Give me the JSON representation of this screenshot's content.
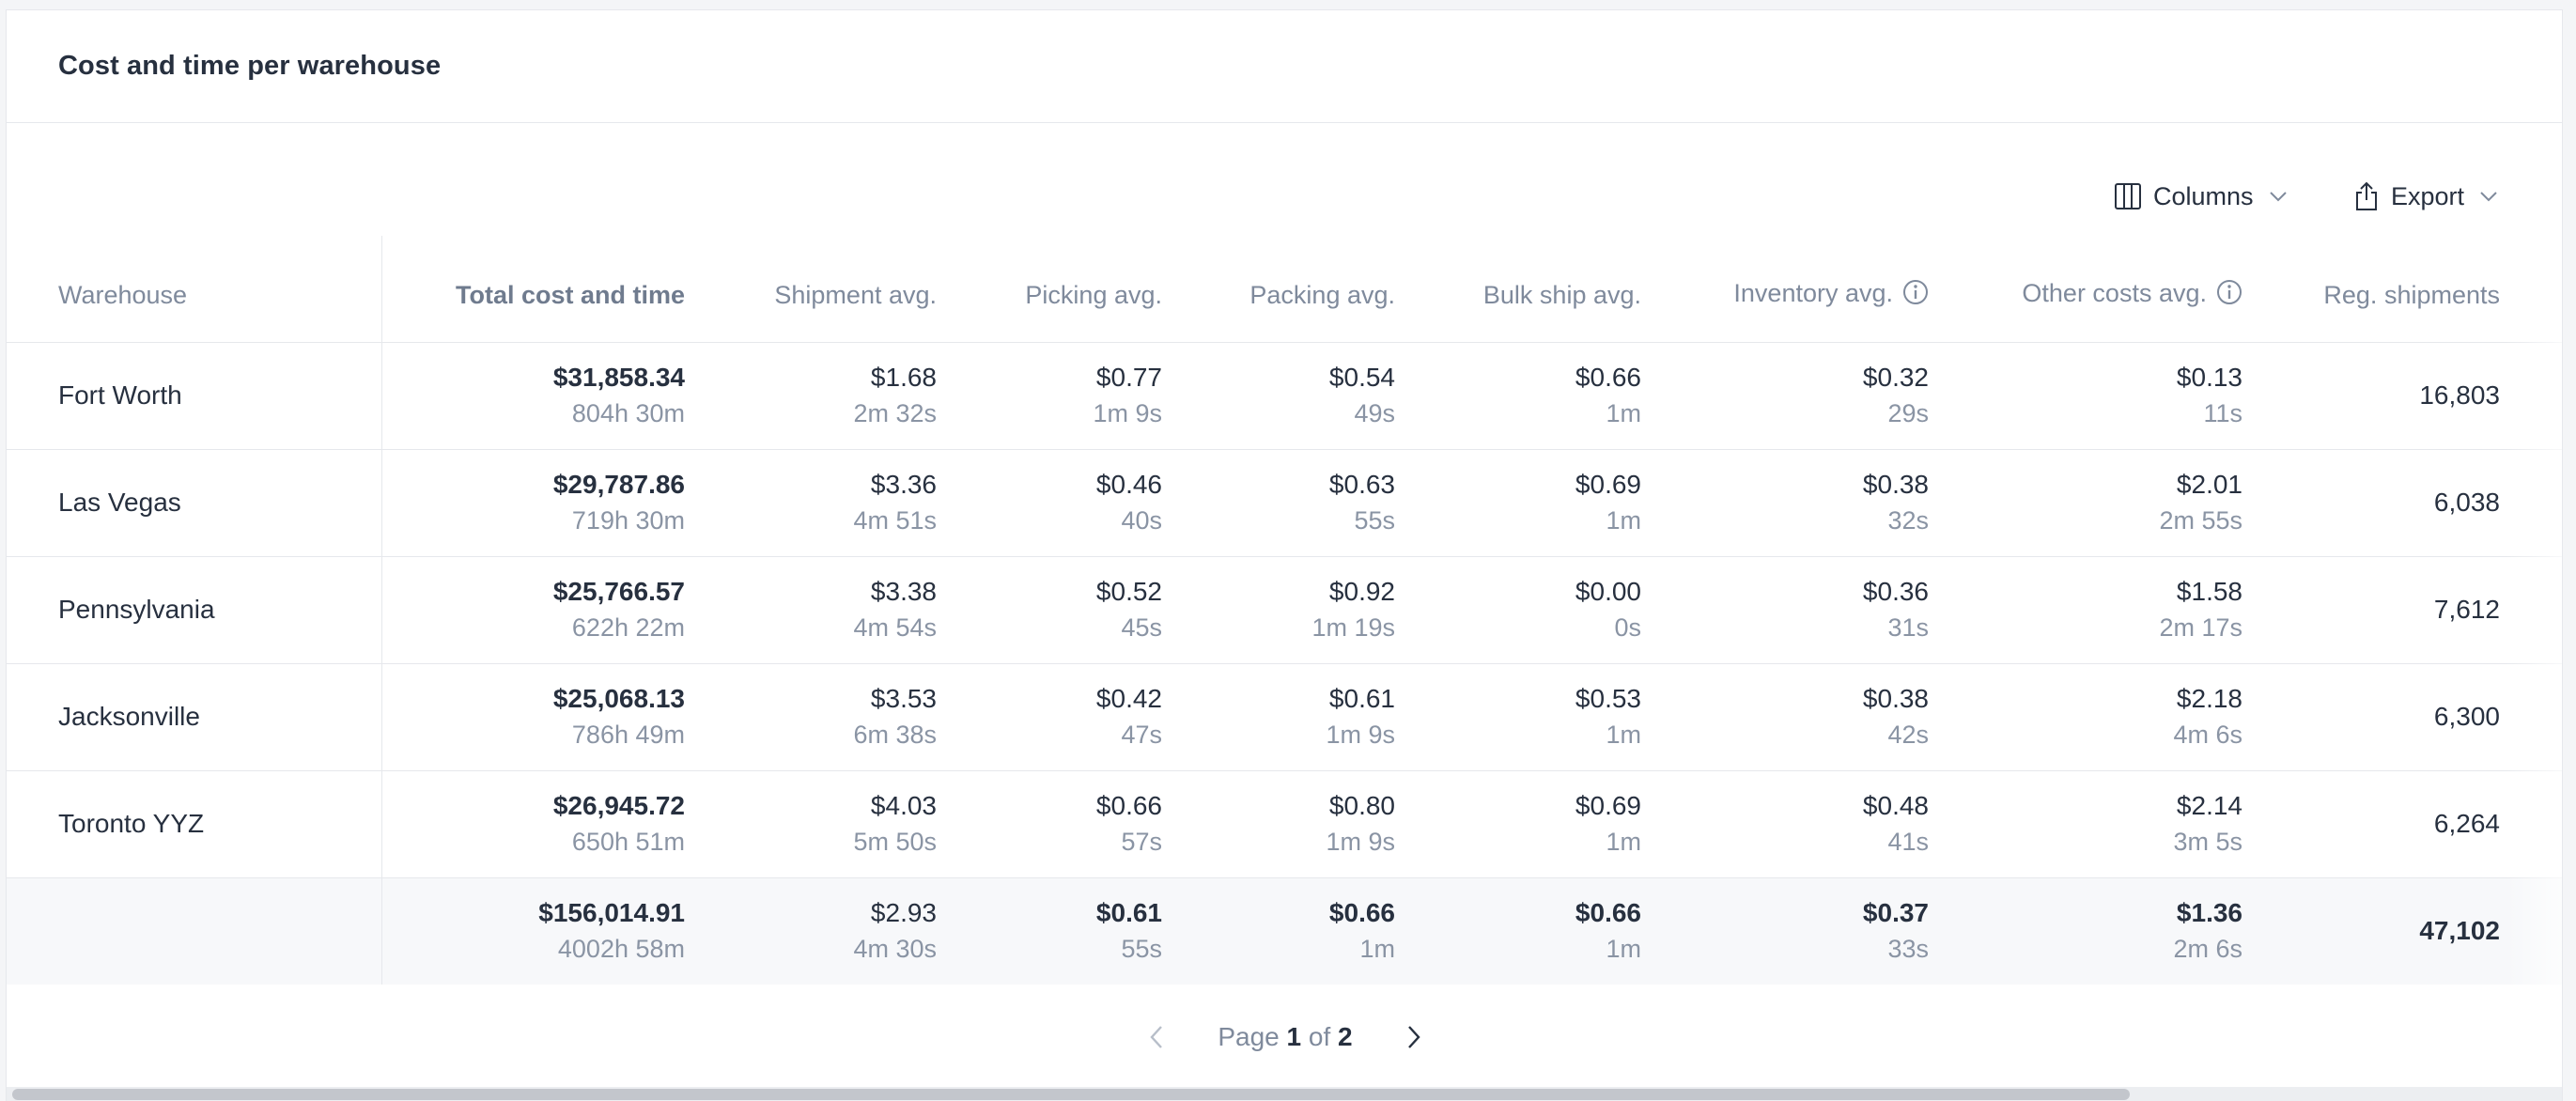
{
  "card": {
    "title": "Cost and time per warehouse"
  },
  "toolbar": {
    "columns_label": "Columns",
    "export_label": "Export"
  },
  "table": {
    "columns": [
      "Warehouse",
      "Total cost and time",
      "Shipment avg.",
      "Picking avg.",
      "Packing avg.",
      "Bulk ship avg.",
      "Inventory avg.",
      "Other costs avg.",
      "Reg. shipments"
    ],
    "rows": [
      {
        "warehouse": "Fort Worth",
        "total": [
          "$31,858.34",
          "804h 30m"
        ],
        "shipment": [
          "$1.68",
          "2m 32s"
        ],
        "picking": [
          "$0.77",
          "1m 9s"
        ],
        "packing": [
          "$0.54",
          "49s"
        ],
        "bulk": [
          "$0.66",
          "1m"
        ],
        "inventory": [
          "$0.32",
          "29s"
        ],
        "other": [
          "$0.13",
          "11s"
        ],
        "reg": "16,803"
      },
      {
        "warehouse": "Las Vegas",
        "total": [
          "$29,787.86",
          "719h 30m"
        ],
        "shipment": [
          "$3.36",
          "4m 51s"
        ],
        "picking": [
          "$0.46",
          "40s"
        ],
        "packing": [
          "$0.63",
          "55s"
        ],
        "bulk": [
          "$0.69",
          "1m"
        ],
        "inventory": [
          "$0.38",
          "32s"
        ],
        "other": [
          "$2.01",
          "2m 55s"
        ],
        "reg": "6,038"
      },
      {
        "warehouse": "Pennsylvania",
        "total": [
          "$25,766.57",
          "622h 22m"
        ],
        "shipment": [
          "$3.38",
          "4m 54s"
        ],
        "picking": [
          "$0.52",
          "45s"
        ],
        "packing": [
          "$0.92",
          "1m 19s"
        ],
        "bulk": [
          "$0.00",
          "0s"
        ],
        "inventory": [
          "$0.36",
          "31s"
        ],
        "other": [
          "$1.58",
          "2m 17s"
        ],
        "reg": "7,612"
      },
      {
        "warehouse": "Jacksonville",
        "total": [
          "$25,068.13",
          "786h 49m"
        ],
        "shipment": [
          "$3.53",
          "6m 38s"
        ],
        "picking": [
          "$0.42",
          "47s"
        ],
        "packing": [
          "$0.61",
          "1m 9s"
        ],
        "bulk": [
          "$0.53",
          "1m"
        ],
        "inventory": [
          "$0.38",
          "42s"
        ],
        "other": [
          "$2.18",
          "4m 6s"
        ],
        "reg": "6,300"
      },
      {
        "warehouse": "Toronto YYZ",
        "total": [
          "$26,945.72",
          "650h 51m"
        ],
        "shipment": [
          "$4.03",
          "5m 50s"
        ],
        "picking": [
          "$0.66",
          "57s"
        ],
        "packing": [
          "$0.80",
          "1m 9s"
        ],
        "bulk": [
          "$0.69",
          "1m"
        ],
        "inventory": [
          "$0.48",
          "41s"
        ],
        "other": [
          "$2.14",
          "3m 5s"
        ],
        "reg": "6,264"
      }
    ],
    "totals": {
      "total": [
        "$156,014.91",
        "4002h 58m"
      ],
      "shipment": [
        "$2.93",
        "4m 30s"
      ],
      "picking": [
        "$0.61",
        "55s"
      ],
      "packing": [
        "$0.66",
        "1m"
      ],
      "bulk": [
        "$0.66",
        "1m"
      ],
      "inventory": [
        "$0.37",
        "33s"
      ],
      "other": [
        "$1.36",
        "2m 6s"
      ],
      "reg": "47,102"
    }
  },
  "pager": {
    "prefix": "Page",
    "current": "1",
    "of": "of",
    "total": "2"
  },
  "icons": {
    "columns": "columns-icon",
    "export": "share-export-icon",
    "dropdown": "chevron-down-icon",
    "info": "info-circle-icon",
    "prev": "chevron-left-icon",
    "next": "chevron-right-icon"
  }
}
